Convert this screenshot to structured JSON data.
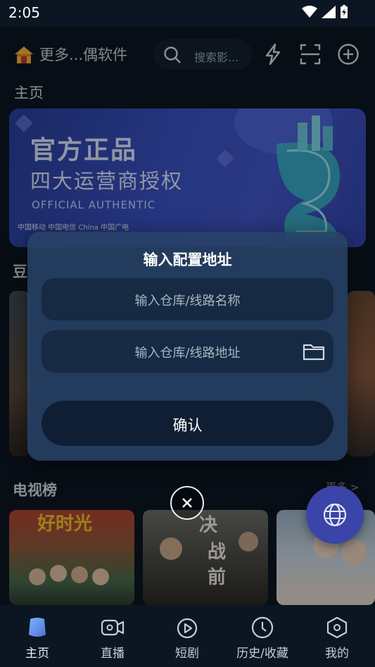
{
  "status": {
    "time": "2:05"
  },
  "topbar": {
    "title": "更多...偶软件",
    "search_placeholder": "搜索影..."
  },
  "home": {
    "section_label": "主页",
    "banner": {
      "line1": "官方正品",
      "line2": "四大运营商授权",
      "line3": "OFFICIAL AUTHENTIC",
      "carriers": "中国移动   中国电信   China   中国广电"
    },
    "douban_partial": "豆",
    "tv_section": {
      "title": "电视榜",
      "more": "更多 >"
    }
  },
  "dialog": {
    "title": "输入配置地址",
    "name_placeholder": "输入仓库/线路名称",
    "url_placeholder": "输入仓库/线路地址",
    "confirm_label": "确认"
  },
  "bottom_nav": {
    "items": [
      {
        "label": "主页"
      },
      {
        "label": "直播"
      },
      {
        "label": "短剧"
      },
      {
        "label": "历史/收藏"
      },
      {
        "label": "我的"
      }
    ]
  },
  "colors": {
    "accent": "#3b44a8",
    "background": "#0b1622",
    "dialog": "#284266"
  }
}
